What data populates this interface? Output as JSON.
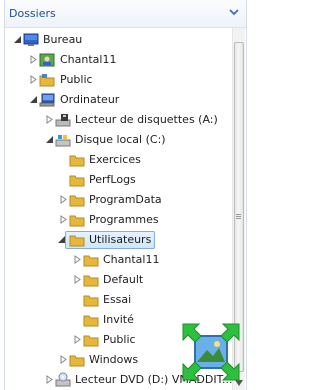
{
  "header": {
    "title": "Dossiers",
    "chevron_icon": "chevron-down-icon"
  },
  "colors": {
    "folder": "#e7b73a",
    "header_text": "#1f4e8c",
    "selection": "#cfe6fb",
    "badge": "#2fbf3f"
  },
  "tree": {
    "bureau": "Bureau",
    "chantal_top": "Chantal11",
    "public_top": "Public",
    "ordinateur": "Ordinateur",
    "disquettes": "Lecteur de disquettes (A:)",
    "disque_c": "Disque local (C:)",
    "exercices": "Exercices",
    "perflogs": "PerfLogs",
    "programdata": "ProgramData",
    "programmes": "Programmes",
    "utilisateurs": "Utilisateurs",
    "chantal_user": "Chantal11",
    "default": "Default",
    "essai": "Essai",
    "invite": "Invité",
    "public_user": "Public",
    "windows": "Windows",
    "dvd": "Lecteur DVD (D:) VMADDIT..."
  }
}
